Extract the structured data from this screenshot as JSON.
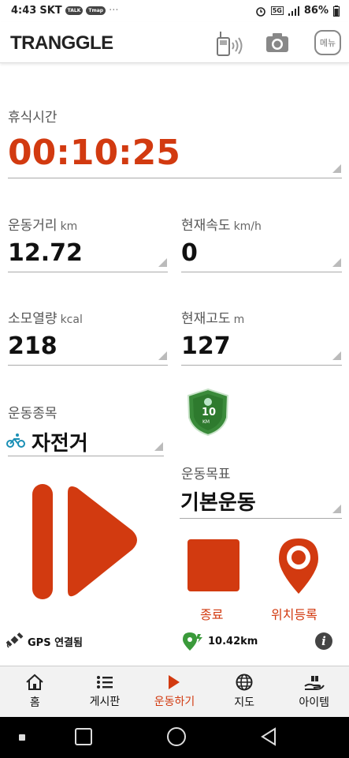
{
  "status_bar": {
    "time": "4:43",
    "carrier": "SKT",
    "pill1": "TALK",
    "pill2": "Tmap",
    "dots": "···",
    "network": "5G",
    "battery": "86%"
  },
  "app": {
    "logo": "TRANGGLE",
    "menu_label": "메뉴"
  },
  "rest_time": {
    "label": "휴식시간",
    "value": "00:10:25"
  },
  "distance": {
    "label": "운동거리",
    "unit": "km",
    "value": "12.72"
  },
  "speed": {
    "label": "현재속도",
    "unit": "km/h",
    "value": "0"
  },
  "calories": {
    "label": "소모열량",
    "unit": "kcal",
    "value": "218"
  },
  "altitude": {
    "label": "현재고도",
    "unit": "m",
    "value": "127"
  },
  "exercise_type": {
    "label": "운동종목",
    "value": "자전거"
  },
  "badge": {
    "number": "10",
    "unit": "KM"
  },
  "goal": {
    "label": "운동목표",
    "value": "기본운동"
  },
  "actions": {
    "stop_label": "종료",
    "location_label": "위치등록"
  },
  "gps": {
    "status": "GPS 연결됨",
    "distance": "10.42km"
  },
  "nav": [
    {
      "label": "홈",
      "icon": "home-icon"
    },
    {
      "label": "게시판",
      "icon": "list-icon"
    },
    {
      "label": "운동하기",
      "icon": "play-icon"
    },
    {
      "label": "지도",
      "icon": "globe-icon"
    },
    {
      "label": "아이템",
      "icon": "gift-hand-icon"
    }
  ],
  "colors": {
    "accent": "#d23a10",
    "badge_green": "#3a8a3a"
  }
}
